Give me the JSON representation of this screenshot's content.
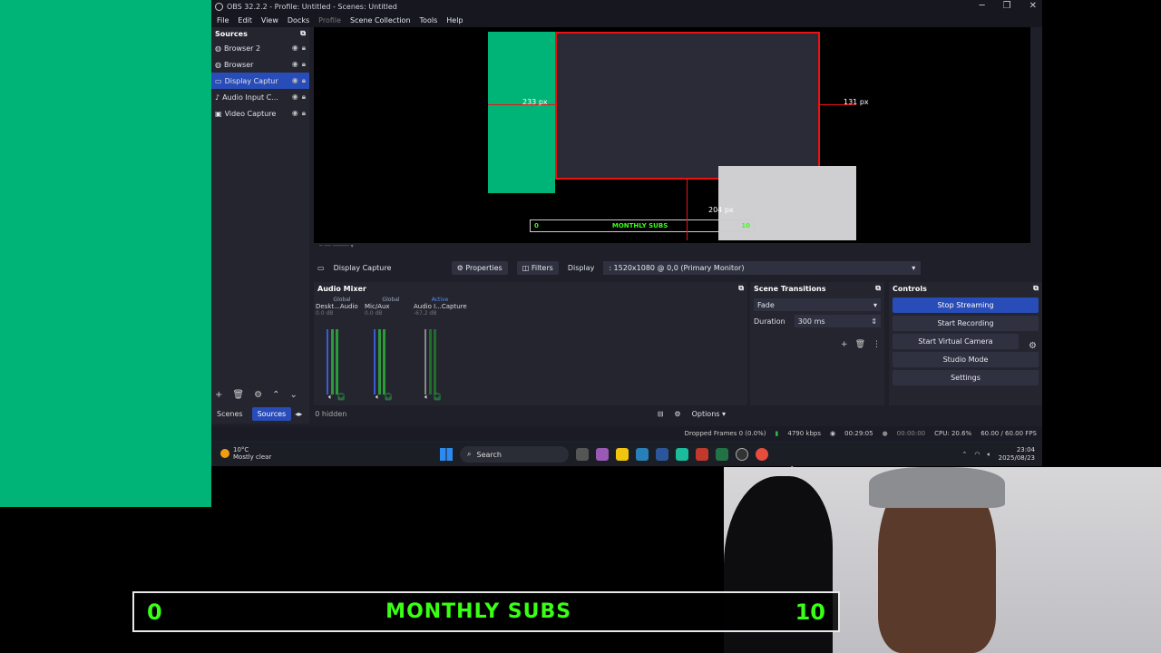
{
  "window": {
    "title": "OBS 32.2.2 - Profile: Untitled - Scenes: Untitled",
    "controls": {
      "minimize": "─",
      "maximize": "❐",
      "close": "✕"
    }
  },
  "menu": [
    "File",
    "Edit",
    "View",
    "Docks",
    "Profile",
    "Scene Collection",
    "Tools",
    "Help"
  ],
  "sources": {
    "title": "Sources",
    "items": [
      {
        "label": "Browser 2"
      },
      {
        "label": "Browser"
      },
      {
        "label": "Display Captur"
      },
      {
        "label": "Audio Input C..."
      },
      {
        "label": "Video Capture"
      }
    ],
    "hidden_count": "0 hidden",
    "tabs": {
      "scenes": "Scenes",
      "sources": "Sources"
    }
  },
  "preview": {
    "px_left": "233 px",
    "px_right": "131 px",
    "px_bottom": "204 px",
    "bar_left": "0",
    "bar_title": "MONTHLY SUBS",
    "bar_right": "10"
  },
  "properties_bar": {
    "source_name": "Display Capture",
    "properties": "Properties",
    "filters": "Filters",
    "display_label": "Display",
    "display_value": ": 1520x1080 @ 0,0 (Primary Monitor)"
  },
  "mixer": {
    "title": "Audio Mixer",
    "channels": [
      {
        "tag": "Global",
        "name": "Deskt...Audio",
        "db": "0.0 dB"
      },
      {
        "tag": "Global",
        "name": "Mic/Aux",
        "db": "0.0 dB"
      },
      {
        "tag": "Active",
        "name": "Audio I...Capture",
        "db": "-67.2 dB"
      }
    ]
  },
  "transitions": {
    "title": "Scene Transitions",
    "type": "Fade",
    "duration_label": "Duration",
    "duration_value": "300 ms"
  },
  "controls": {
    "title": "Controls",
    "stop_streaming": "Stop Streaming",
    "start_recording": "Start Recording",
    "start_virtual_camera": "Start Virtual Camera",
    "studio_mode": "Studio Mode",
    "settings": "Settings",
    "options": "Options"
  },
  "status": {
    "dropped_frames": "Dropped Frames 0 (0.0%)",
    "bitrate": "4790 kbps",
    "stream_time": "00:29:05",
    "record_time": "00:00:00",
    "cpu": "CPU: 20.6%",
    "fps": "60.00 / 60.00 FPS"
  },
  "taskbar": {
    "temp": "10°C",
    "weather": "Mostly clear",
    "search": "Search",
    "time": "23:04",
    "date": "2025/08/23"
  },
  "overlay": {
    "left": "0",
    "title": "MONTHLY SUBS",
    "right": "10"
  },
  "colors": {
    "green_screen": "#00b477",
    "accent_blue": "#284cb8",
    "subs_green": "#39ff14"
  }
}
